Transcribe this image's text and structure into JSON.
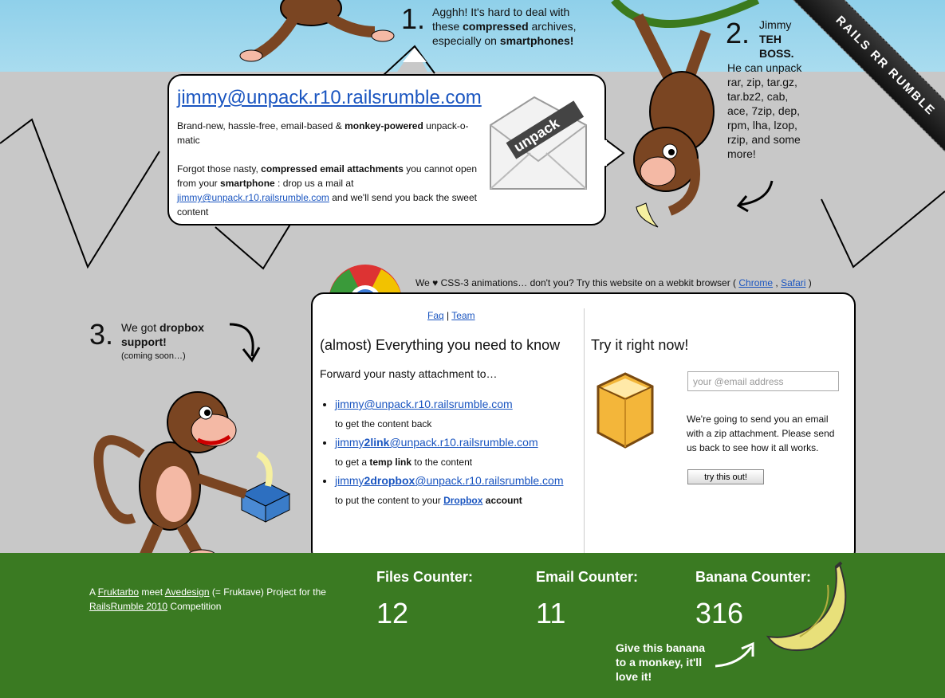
{
  "steps": {
    "one": {
      "num": "1.",
      "text_a": "Agghh! It's hard to deal with these ",
      "bold": "compressed",
      "text_b": " archives, especially on ",
      "bold2": "smartphones!"
    },
    "two": {
      "num": "2.",
      "name": "Jimmy",
      "title": "TEH BOSS.",
      "body": "He can unpack rar, zip, tar.gz, tar.bz2, cab, ace, 7zip, dep, rpm, lha, lzop, rzip, and some more!"
    },
    "three": {
      "num": "3.",
      "text_a": "We got ",
      "bold": "dropbox support!",
      "note": "(coming soon…)"
    }
  },
  "bubble": {
    "email": "jimmy@unpack.r10.railsrumble.com",
    "tagline_a": "Brand-new, hassle-free, email-based & ",
    "tagline_bold": "monkey-powered",
    "tagline_b": " unpack-o-matic",
    "desc_a": "Forgot those nasty, ",
    "desc_bold": "compressed email attachments",
    "desc_b": " you cannot open from your ",
    "desc_bold2": "smartphone",
    "desc_c": " : drop us a mail at ",
    "desc_link": "jimmy@unpack.r10.railsrumble.com",
    "desc_d": " and we'll send you back the sweet content",
    "envelope_word": "unpack"
  },
  "css3_note": {
    "text": "We ♥ CSS-3 animations… don't you? Try this website on a webkit browser ( ",
    "chrome": "Chrome",
    "sep": " , ",
    "safari": "Safari",
    "end": " )"
  },
  "panel": {
    "nav": {
      "faq": "Faq",
      "sep": " | ",
      "team": "Team"
    },
    "left_title": "(almost) Everything you need to know",
    "forward": "Forward your nasty attachment to…",
    "addresses": [
      {
        "pre": "jimmy",
        "bold": "",
        "post": "@unpack.r10.railsrumble.com",
        "sub_a": "to get the content back",
        "sub_bold": "",
        "sub_b": ""
      },
      {
        "pre": "jimmy",
        "bold": "2link",
        "post": "@unpack.r10.railsrumble.com",
        "sub_a": "to get a ",
        "sub_bold": "temp link",
        "sub_b": " to the content"
      },
      {
        "pre": "jimmy",
        "bold": "2dropbox",
        "post": "@unpack.r10.railsrumble.com",
        "sub_a": "to put the content to your ",
        "sub_link": "Dropbox",
        "sub_bold": " account",
        "sub_b": ""
      }
    ],
    "right_title": "Try it right now!",
    "email_placeholder": "your @email address",
    "explain": "We're going to send you an email with a zip attachment. Please send us back to see how it all works.",
    "button": "try this out!"
  },
  "footer": {
    "credit_a": "A ",
    "fruktarbo": "Fruktarbo",
    "credit_b": " meet ",
    "avedesign": "Avedesign",
    "credit_c": " (= Fruktave) Project for the ",
    "railsrumble": "RailsRumble 2010",
    "credit_d": " Competition",
    "counters": [
      {
        "label": "Files Counter:",
        "value": "12"
      },
      {
        "label": "Email Counter:",
        "value": "11"
      },
      {
        "label": "Banana Counter:",
        "value": "316"
      }
    ],
    "banana_note": "Give this banana to a monkey, it'll love it!"
  },
  "ribbon": {
    "text": "RAILS RR RUMBLE"
  }
}
